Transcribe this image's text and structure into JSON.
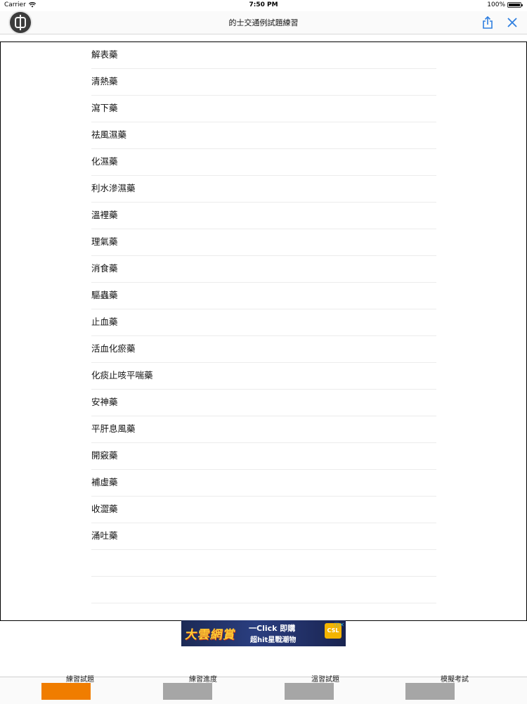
{
  "status_bar": {
    "carrier": "Carrier",
    "time": "7:50 PM",
    "battery": "100%"
  },
  "nav": {
    "title": "的士交通例試題練習",
    "logo_icon": "logo-icon",
    "share_icon": "share-icon",
    "close_icon": "close-icon",
    "accent_color": "#2f7fe0"
  },
  "list": {
    "items": [
      "解表藥",
      "清熱藥",
      "瀉下藥",
      "祛風濕藥",
      "化濕藥",
      "利水滲濕藥",
      "溫裡藥",
      "理氣藥",
      "消食藥",
      "驅蟲藥",
      "止血藥",
      "活血化瘀藥",
      "化痰止咳平喘藥",
      "安神藥",
      "平肝息風藥",
      "開竅藥",
      "補虛藥",
      "收澀藥",
      "涌吐藥",
      "",
      ""
    ]
  },
  "ad": {
    "left_text": "大雲網賞",
    "mid_top": "一Click 即購",
    "mid_bottom": "超hit星戰潮物",
    "badge": "CSL",
    "close": "ⓘ✕"
  },
  "tabs": [
    {
      "label": "練習試題",
      "color": "#f07d00",
      "selected": true
    },
    {
      "label": "練習進度",
      "color": "#a6a6a6",
      "selected": false
    },
    {
      "label": "溫習試題",
      "color": "#a6a6a6",
      "selected": false
    },
    {
      "label": "模擬考試",
      "color": "#a6a6a6",
      "selected": false
    }
  ]
}
